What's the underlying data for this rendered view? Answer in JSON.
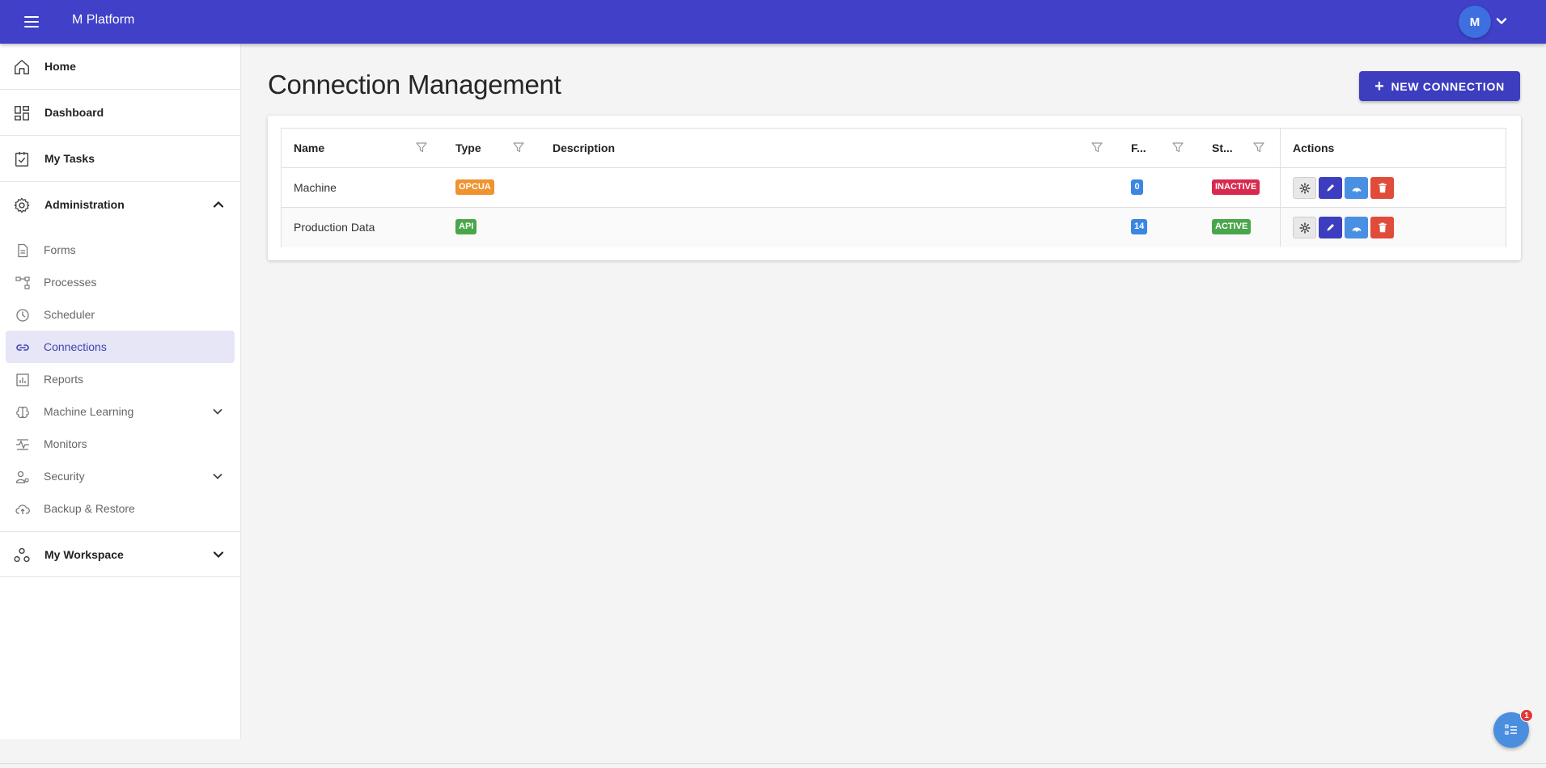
{
  "header": {
    "app_title": "M Platform",
    "avatar_initial": "M"
  },
  "sidebar": {
    "main_items": [
      {
        "label": "Home",
        "icon": "home-icon"
      },
      {
        "label": "Dashboard",
        "icon": "dashboard-icon"
      },
      {
        "label": "My Tasks",
        "icon": "tasks-icon"
      },
      {
        "label": "Administration",
        "icon": "gear-icon",
        "expanded": true
      }
    ],
    "admin_items": [
      {
        "label": "Forms",
        "icon": "document-icon"
      },
      {
        "label": "Processes",
        "icon": "process-icon"
      },
      {
        "label": "Scheduler",
        "icon": "clock-icon"
      },
      {
        "label": "Connections",
        "icon": "link-icon",
        "active": true
      },
      {
        "label": "Reports",
        "icon": "report-icon"
      },
      {
        "label": "Machine Learning",
        "icon": "brain-icon",
        "expandable": true
      },
      {
        "label": "Monitors",
        "icon": "monitor-icon"
      },
      {
        "label": "Security",
        "icon": "security-icon",
        "expandable": true
      },
      {
        "label": "Backup & Restore",
        "icon": "cloud-icon"
      }
    ],
    "workspace": {
      "label": "My Workspace",
      "icon": "workspace-icon"
    }
  },
  "main": {
    "title": "Connection Management",
    "new_button_label": "NEW CONNECTION",
    "table": {
      "columns": [
        "Name",
        "Type",
        "Description",
        "F...",
        "St...",
        "Actions"
      ],
      "rows": [
        {
          "name": "Machine",
          "type": "OPCUA",
          "description": "",
          "f": "0",
          "status": "INACTIVE"
        },
        {
          "name": "Production Data",
          "type": "API",
          "description": "",
          "f": "14",
          "status": "ACTIVE"
        }
      ]
    }
  },
  "fab": {
    "badge_count": "1"
  },
  "colors": {
    "topbar": "#4040c8",
    "accent": "#3d3dbf",
    "opcua_badge": "#f0922e",
    "api_badge": "#4aa64a",
    "count_badge": "#3a86e0",
    "inactive_badge": "#d8294f",
    "active_badge": "#4aa64a",
    "delete": "#e04b3a",
    "signal": "#4a90e2"
  }
}
